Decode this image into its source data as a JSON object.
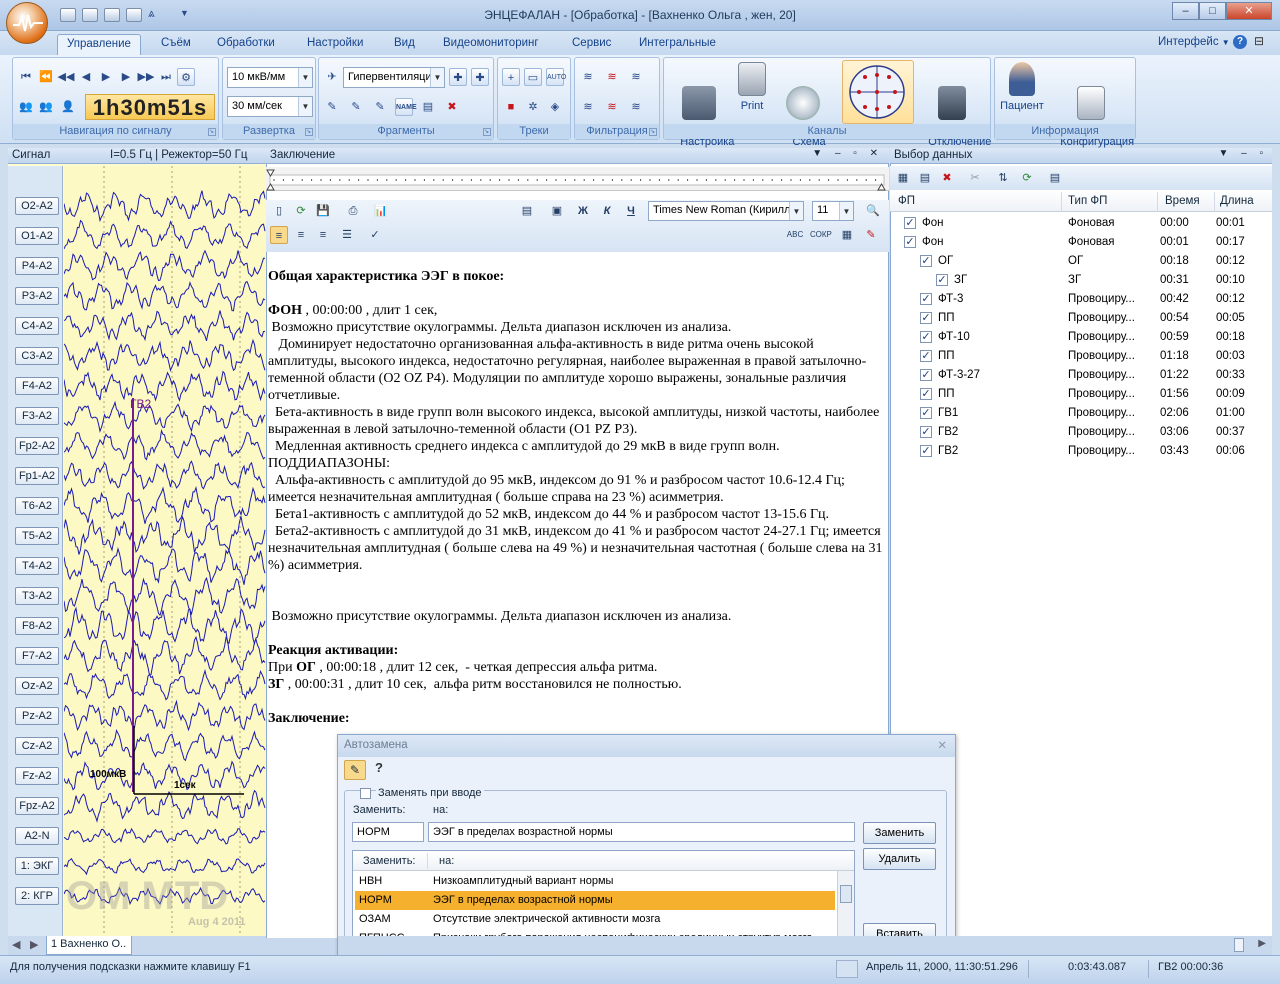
{
  "window": {
    "title": "ЭНЦЕФАЛАН - [Обработка] - [Вахненко Ольга , жен, 20]",
    "min": "–",
    "max": "□",
    "close": "✕"
  },
  "menu": {
    "tabs": [
      "Управление",
      "Съём",
      "Обработки",
      "Настройки",
      "Вид",
      "Видеомониторинг",
      "Сервис",
      "Интегральные"
    ],
    "interface": "Интерфейс",
    "help": "?"
  },
  "ribbon": {
    "nav_group": "Навигация по сигналу",
    "timer": "1h30m51s",
    "sweep_group": "Развертка",
    "sens": "10 мкВ/мм",
    "speed": "30 мм/сек",
    "frag_group": "Фрагменты",
    "frag_combo": "Гипервентиляция",
    "tracks_group": "Треки",
    "filter_group": "Фильтрация",
    "channels_group": "Каналы",
    "ch_setup": "Настройка\nканалов",
    "print": "Print",
    "scheme": "Схема\nотведений",
    "ch_off": "Отключение\nканалов",
    "info_group": "Информация",
    "patient": "Пациент",
    "config": "Конфигурация\nсъёма"
  },
  "signal": {
    "title": "Сигнал",
    "params": "I=0.5 Гц | Режектор=50 Гц",
    "channels": [
      "O2-A2",
      "O1-A2",
      "P4-A2",
      "P3-A2",
      "C4-A2",
      "C3-A2",
      "F4-A2",
      "F3-A2",
      "Fp2-A2",
      "Fp1-A2",
      "T6-A2",
      "T5-A2",
      "T4-A2",
      "T3-A2",
      "F8-A2",
      "F7-A2",
      "Oz-A2",
      "Pz-A2",
      "Cz-A2",
      "Fz-A2",
      "Fpz-A2",
      "A2-N",
      "1: ЭКГ",
      "2: КГР"
    ],
    "marker": "ГВ2",
    "amp_scale": "100мкВ",
    "time_scale": "1сек",
    "watermark": "OM MTD",
    "date_wm": "Aug  4 2011",
    "sheet_tab": "1 Вахненко О.."
  },
  "conclusion": {
    "title": "Заключение",
    "font": "Times New Roman (Кирилли",
    "size": "11",
    "bold": "Ж",
    "italic": "К",
    "underline": "Ч",
    "h1": "Общая характеристика ЭЭГ в покое:",
    "fon_b": "ФОН",
    "fon_t": " , 00:00:00 , длит 1 сек,",
    "lines": [
      " Возможно присутствие окулограммы. Дельта диапазон исключен из анализа.",
      "   Доминирует недостаточно организованная альфа-активность в виде ритма очень высокой амплитуды, высокого индекса, недостаточно регулярная, наиболее выраженная в правой затылочно-теменной области (O2 OZ P4). Модуляции по амплитуде хорошо выражены, зональные различия отчетливые.",
      "  Бета-активность в виде групп волн высокого индекса, высокой амплитуды, низкой частоты, наиболее выраженная в левой затылочно-теменной области (O1 PZ P3).",
      "  Медленная активность среднего индекса с амплитудой до 29 мкВ в виде групп волн.",
      "ПОДДИАПАЗОНЫ:",
      "  Альфа-активность с амплитудой до 95 мкВ, индексом до 91 % и разбросом частот 10.6-12.4 Гц; имеется незначительная амплитудная ( больше справа на 23 %) асимметрия.",
      "  Бета1-активность с амплитудой до 52 мкВ, индексом до 44 % и разбросом частот 13-15.6 Гц.",
      "  Бета2-активность с амплитудой до 31 мкВ, индексом до 41 % и разбросом частот 24-27.1 Гц; имеется незначительная амплитудная ( больше слева на 49 %) и незначительная частотная ( больше слева на 31 %) асимметрия."
    ],
    "repeat": " Возможно присутствие окулограммы. Дельта диапазон исключен из анализа.",
    "h2": "Реакция активации:",
    "og_pre": "При ",
    "og_b": "ОГ",
    "og_t": " , 00:00:18 , длит 12 сек,  - четкая депрессия альфа ритма.",
    "zg_b": "ЗГ",
    "zg_t": " , 00:00:31 , длит 10 сек,  альфа ритм восстановился не полностью.",
    "h3": "Заключение:"
  },
  "data_panel": {
    "title": "Выбор данных",
    "cols": [
      "ФП",
      "Тип ФП",
      "Время",
      "Длина"
    ],
    "rows": [
      {
        "fp": "Фон",
        "type": "Фоновая",
        "time": "00:00",
        "len": "00:01"
      },
      {
        "fp": "Фон",
        "type": "Фоновая",
        "time": "00:01",
        "len": "00:17"
      },
      {
        "fp": "ОГ",
        "type": "ОГ",
        "time": "00:18",
        "len": "00:12"
      },
      {
        "fp": "ЗГ",
        "type": "ЗГ",
        "time": "00:31",
        "len": "00:10"
      },
      {
        "fp": "ФТ-3",
        "type": "Провоциру...",
        "time": "00:42",
        "len": "00:12"
      },
      {
        "fp": "ПП",
        "type": "Провоциру...",
        "time": "00:54",
        "len": "00:05"
      },
      {
        "fp": "ФТ-10",
        "type": "Провоциру...",
        "time": "00:59",
        "len": "00:18"
      },
      {
        "fp": "ПП",
        "type": "Провоциру...",
        "time": "01:18",
        "len": "00:03"
      },
      {
        "fp": "ФТ-3-27",
        "type": "Провоциру...",
        "time": "01:22",
        "len": "00:33"
      },
      {
        "fp": "ПП",
        "type": "Провоциру...",
        "time": "01:56",
        "len": "00:09"
      },
      {
        "fp": "ГВ1",
        "type": "Провоциру...",
        "time": "02:06",
        "len": "01:00"
      },
      {
        "fp": "ГВ2",
        "type": "Провоциру...",
        "time": "03:06",
        "len": "00:37"
      },
      {
        "fp": "ГВ2",
        "type": "Провоциру...",
        "time": "03:43",
        "len": "00:06"
      }
    ]
  },
  "autoreplace": {
    "title": "Автозамена",
    "close": "✕",
    "checkbox": "Заменять при вводе",
    "replace_lbl": "Заменить:",
    "with_lbl": "на:",
    "replace_val": "НОРМ",
    "with_val": "ЭЭГ в пределах  возрастной нормы",
    "btn_replace": "Заменить",
    "btn_delete": "Удалить",
    "btn_insert": "Вставить",
    "col1": "Заменить:",
    "col2": "на:",
    "list": [
      {
        "k": "НВН",
        "v": "Низкоамплитудный  вариант нормы"
      },
      {
        "k": "НОРМ",
        "v": "ЭЭГ в пределах  возрастной нормы"
      },
      {
        "k": "ОЗАМ",
        "v": "Отсутствие  электрической активности мозга"
      },
      {
        "k": "ПГПНСС",
        "v": "Признаки  грубого  поражения  неспецифических срединных структур мозга"
      }
    ]
  },
  "status": {
    "hint": "Для получения подсказки нажмите клавишу F1",
    "datetime": "Апрель 11, 2000, 11:30:51.296",
    "pos": "0:03:43.087",
    "frag": "ГВ2 00:00:36"
  },
  "colors": {
    "accent": "#15428b",
    "eeg_bg": "#fdf9c4",
    "trace": "#1a1ab4",
    "marker": "#7a1a8c",
    "highlight": "#f5b02e"
  }
}
